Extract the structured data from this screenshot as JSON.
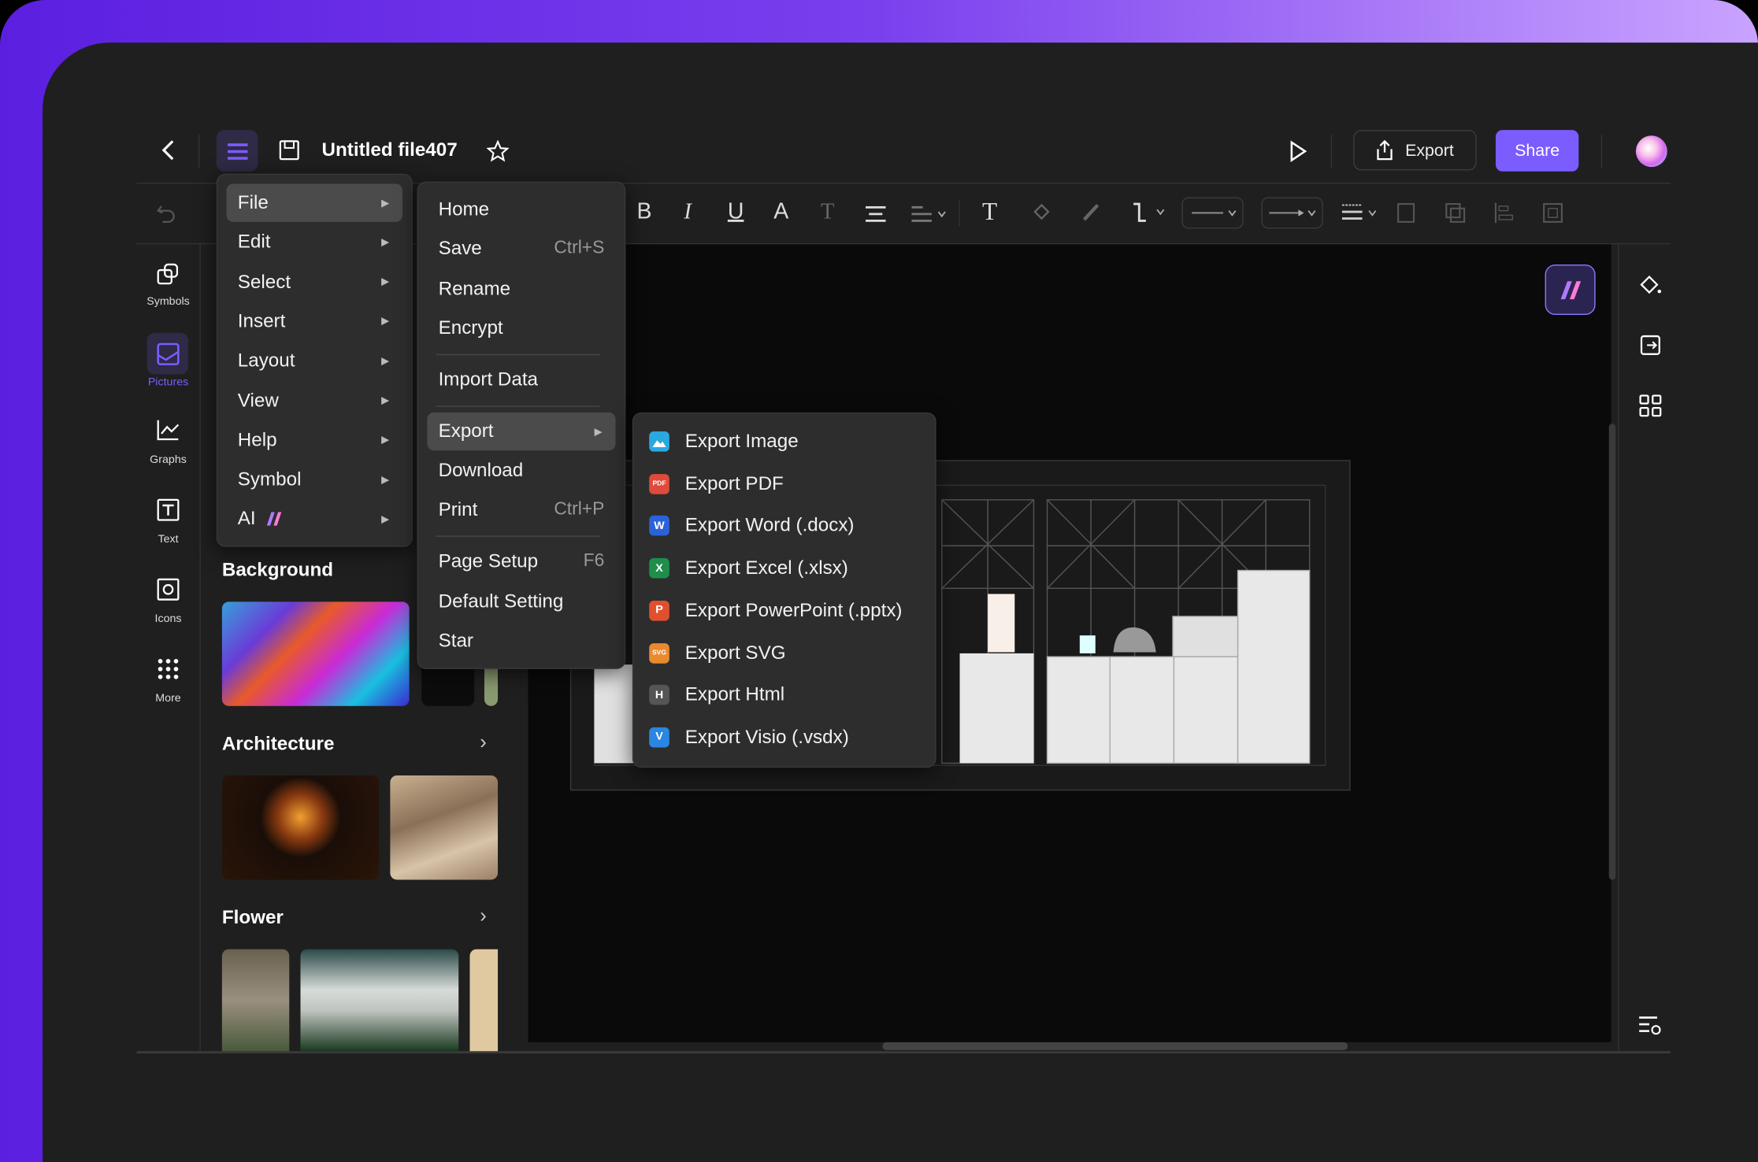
{
  "header": {
    "title": "Untitled file407",
    "export_label": "Export",
    "share_label": "Share"
  },
  "colors": {
    "accent": "#7b5cff",
    "panel": "#1f1f1f",
    "menu": "#2d2d2d"
  },
  "toolbar": {
    "icons": [
      "undo-icon",
      "bold-icon",
      "italic-icon",
      "underline-icon",
      "font-color-icon",
      "text-style-icon",
      "align-icon",
      "line-spacing-icon",
      "text-icon",
      "fill-icon",
      "brush-icon",
      "connector-icon",
      "line-style-select",
      "arrow-style-select",
      "line-weight-icon",
      "bring-front-icon",
      "send-back-icon",
      "align-left-icon",
      "group-icon"
    ],
    "bold": "B",
    "italic": "I",
    "underline": "U",
    "font_color": "A",
    "text_style": "T",
    "text": "T"
  },
  "sidebar": {
    "items": [
      {
        "label": "Symbols",
        "icon": "symbols-icon"
      },
      {
        "label": "Pictures",
        "icon": "pictures-icon",
        "active": true
      },
      {
        "label": "Graphs",
        "icon": "graphs-icon"
      },
      {
        "label": "Text",
        "icon": "text-icon"
      },
      {
        "label": "Icons",
        "icon": "icons-icon"
      },
      {
        "label": "More",
        "icon": "more-icon"
      }
    ]
  },
  "library": {
    "sections": [
      {
        "title": "Background"
      },
      {
        "title": "Architecture"
      },
      {
        "title": "Flower"
      }
    ]
  },
  "main_menu": {
    "items": [
      {
        "label": "File",
        "active": true
      },
      {
        "label": "Edit"
      },
      {
        "label": "Select"
      },
      {
        "label": "Insert"
      },
      {
        "label": "Layout"
      },
      {
        "label": "View"
      },
      {
        "label": "Help"
      },
      {
        "label": "Symbol"
      },
      {
        "label": "AI"
      }
    ]
  },
  "file_menu": {
    "items": [
      {
        "label": "Home"
      },
      {
        "label": "Save",
        "shortcut": "Ctrl+S"
      },
      {
        "label": "Rename"
      },
      {
        "label": "Encrypt"
      },
      {
        "label": "Import Data"
      },
      {
        "label": "Export",
        "active": true
      },
      {
        "label": "Download"
      },
      {
        "label": "Print",
        "shortcut": "Ctrl+P"
      },
      {
        "label": "Page Setup",
        "shortcut": "F6"
      },
      {
        "label": "Default Setting"
      },
      {
        "label": "Star"
      }
    ]
  },
  "export_menu": {
    "items": [
      {
        "label": "Export Image",
        "icon": "image-file-icon",
        "color": "#2aa8e0",
        "badge": ""
      },
      {
        "label": "Export PDF",
        "icon": "pdf-file-icon",
        "color": "#e04a3a",
        "badge": "PDF"
      },
      {
        "label": "Export Word (.docx)",
        "icon": "word-file-icon",
        "color": "#2b62d9",
        "badge": "W"
      },
      {
        "label": "Export Excel (.xlsx)",
        "icon": "excel-file-icon",
        "color": "#1e8e4a",
        "badge": "X"
      },
      {
        "label": "Export PowerPoint (.pptx)",
        "icon": "powerpoint-file-icon",
        "color": "#e0502e",
        "badge": "P"
      },
      {
        "label": "Export SVG",
        "icon": "svg-file-icon",
        "color": "#e88a2e",
        "badge": "SVG"
      },
      {
        "label": "Export Html",
        "icon": "html-file-icon",
        "color": "#555555",
        "badge": "H"
      },
      {
        "label": "Export Visio (.vsdx)",
        "icon": "visio-file-icon",
        "color": "#2a86e0",
        "badge": "V"
      }
    ]
  }
}
